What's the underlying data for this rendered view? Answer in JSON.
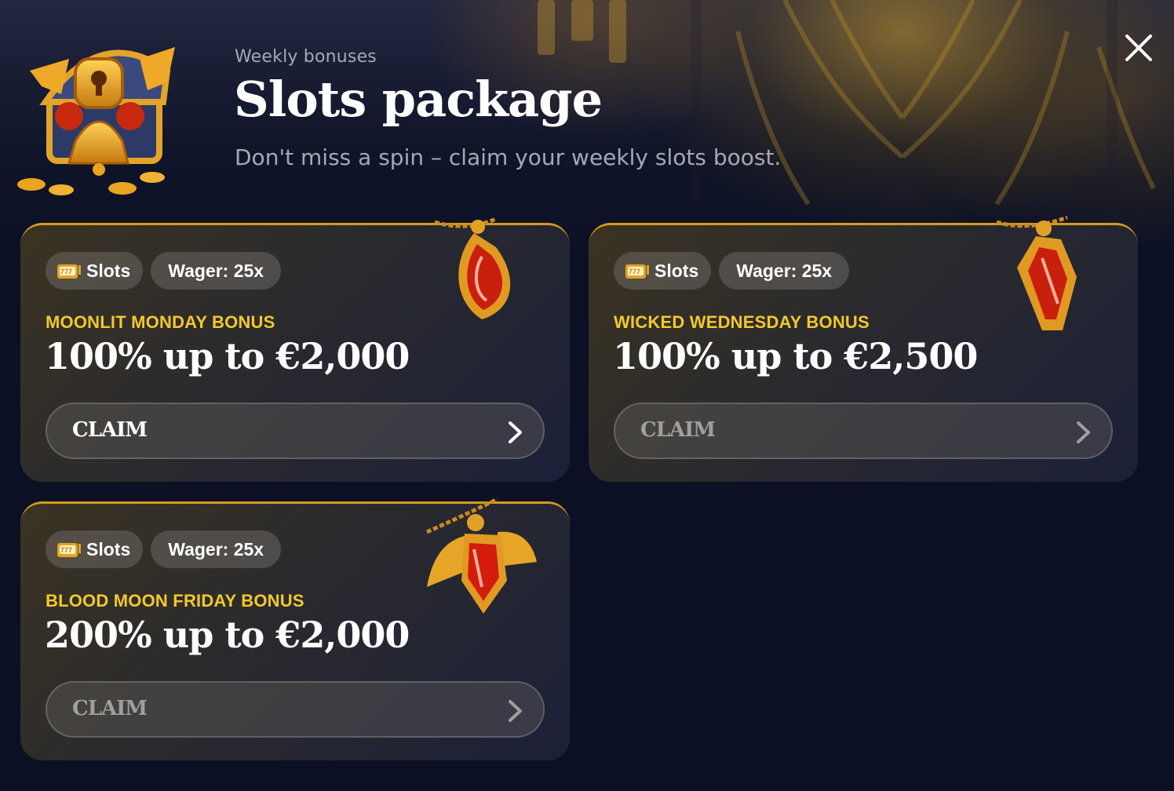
{
  "header": {
    "eyebrow": "Weekly bonuses",
    "title": "Slots package",
    "subtitle": "Don't miss a spin – claim your weekly slots boost."
  },
  "icons": {
    "close": "close-icon",
    "chest": "treasure-chest-icon",
    "slot": "slot-machine-icon",
    "chevron": "chevron-right-icon"
  },
  "colors": {
    "accent": "#f4c82b",
    "border": "#d69a1c",
    "background": "#0c1024"
  },
  "cards": [
    {
      "tag_category": "Slots",
      "tag_wager": "Wager: 25x",
      "bonus_name": "MOONLIT MONDAY BONUS",
      "bonus_amount": "100% up to €2,000",
      "claim_label": "CLAIM",
      "gem": "drop-pendant-icon"
    },
    {
      "tag_category": "Slots",
      "tag_wager": "Wager: 25x",
      "bonus_name": "WICKED WEDNESDAY BONUS",
      "bonus_amount": "100% up to €2,500",
      "claim_label": "CLAIM",
      "gem": "coffin-pendant-icon"
    },
    {
      "tag_category": "Slots",
      "tag_wager": "Wager: 25x",
      "bonus_name": "BLOOD MOON FRIDAY BONUS",
      "bonus_amount": "200% up to €2,000",
      "claim_label": "CLAIM",
      "gem": "bat-wing-pendant-icon"
    }
  ]
}
